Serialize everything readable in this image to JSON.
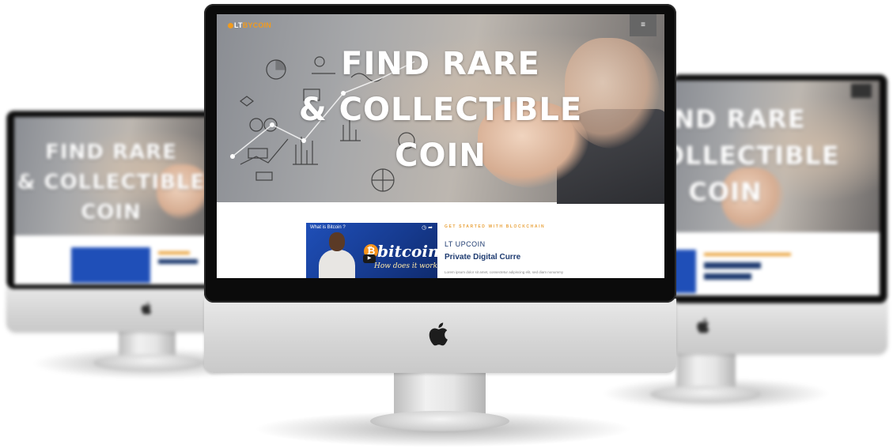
{
  "site": {
    "logo_prefix": "LT",
    "logo_suffix": "BYCOIN",
    "menu_icon": "≡",
    "brand_color": "#f29b1d",
    "navy_color": "#1e3b70"
  },
  "hero": {
    "line1": "FIND RARE",
    "line2": "& COLLECTIBLE",
    "line3": "COIN"
  },
  "video": {
    "title": "What is Bitcoin ?",
    "coin_symbol": "₿",
    "word": "bitcoin",
    "subtitle": "How does it work?",
    "play_icon": "▶",
    "controls": "◷ ➦"
  },
  "section": {
    "kicker": "GET STARTED WITH BLOCKCHAIN",
    "brand": "LT UPCOIN",
    "heading": "Private Digital Curre",
    "lorem": "Lorem ipsum dolor sit amet, consectetur adipiscing elit, sed diam nonummy"
  }
}
